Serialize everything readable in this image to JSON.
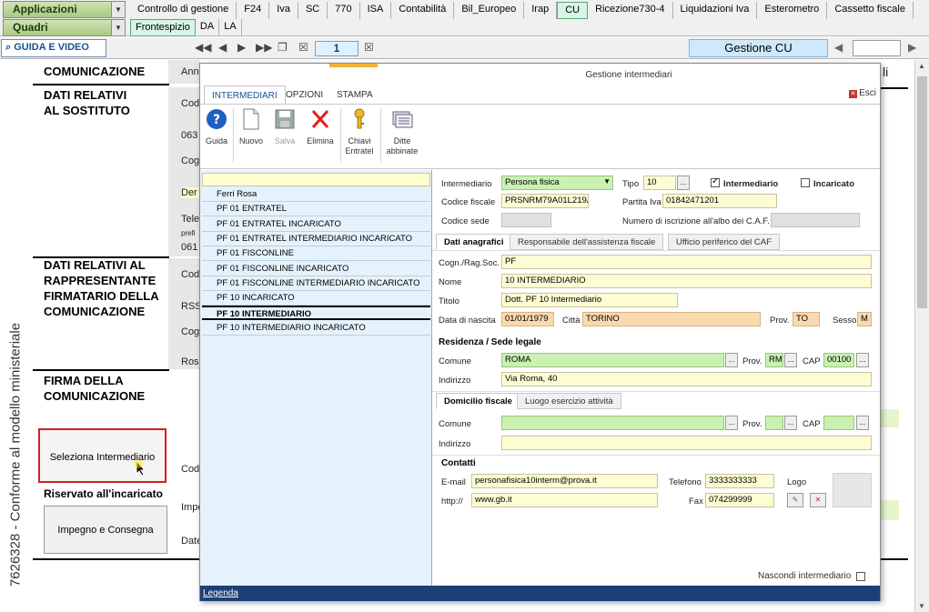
{
  "topbar": {
    "applicazioni": "Applicazioni",
    "quadri": "Quadri",
    "tabs_row1": [
      "Controllo di gestione",
      "F24",
      "Iva",
      "SC",
      "770",
      "ISA",
      "Contabilità",
      "Bil_Europeo",
      "Irap",
      "CU",
      "Ricezione730-4",
      "Liquidazioni Iva",
      "Esterometro",
      "Cassetto fiscale"
    ],
    "tabs_row2": [
      "Frontespizio",
      "DA",
      "LA"
    ],
    "active_tab_row1": "CU",
    "active_tab_row2": "Frontespizio"
  },
  "toolbar": {
    "guida": "GUIDA E VIDEO",
    "page": "1",
    "gestione": "Gestione CU"
  },
  "form": {
    "vertical_text": "7626328 - Conforme al modello ministeriale",
    "sections": {
      "comunicazione": "COMUNICAZIONE",
      "sostituto_1": "DATI RELATIVI",
      "sostituto_2": "AL SOSTITUTO",
      "rappr_1": "DATI RELATIVI AL",
      "rappr_2": "RAPPRESENTANTE",
      "rappr_3": "FIRMATARIO DELLA",
      "rappr_4": "COMUNICAZIONE",
      "firma_1": "FIRMA DELLA",
      "firma_2": "COMUNICAZIONE"
    },
    "fragments": {
      "ann": "Ann",
      "cod1": "Cod",
      "n063": "063",
      "cog1": "Cog",
      "der": "Der",
      "tele": "Tele",
      "prefi": "prefi",
      "n061": "061",
      "cod2": "Cod",
      "rss": "RSS",
      "cog2": "Cog",
      "ros": "Ros",
      "cod3": "Cod",
      "impe": "Impe",
      "date": "Date",
      "li": "li"
    },
    "seleziona": "Seleziona Intermediario",
    "riservato": "Riservato all'incaricato",
    "impegno": "Impegno e Consegna"
  },
  "dialog": {
    "title": "Gestione intermediari",
    "tabs": [
      "INTERMEDIARI",
      "OPZIONI",
      "STAMPA"
    ],
    "esci": "Esci",
    "ribbon": [
      {
        "label": "Guida",
        "icon": "help-icon",
        "disabled": false
      },
      {
        "label": "Nuovo",
        "icon": "new-document-icon",
        "disabled": false
      },
      {
        "label": "Salva",
        "icon": "save-icon",
        "disabled": true
      },
      {
        "label": "Elimina",
        "icon": "delete-icon",
        "disabled": false
      },
      {
        "label": "Chiavi\nEntratel",
        "icon": "key-icon",
        "disabled": false
      },
      {
        "label": "Ditte\nabbinate",
        "icon": "linked-companies-icon",
        "disabled": false
      }
    ],
    "list": [
      "Ferri Rosa",
      "PF 01 ENTRATEL",
      "PF 01 ENTRATEL INCARICATO",
      "PF 01 ENTRATEL INTERMEDIARIO INCARICATO",
      "PF 01 FISCONLINE",
      "PF 01 FISCONLINE INCARICATO",
      "PF 01 FISCONLINE INTERMEDIARIO INCARICATO",
      "PF 10 INCARICATO",
      "PF 10 INTERMEDIARIO",
      "PF 10 INTERMEDIARIO INCARICATO"
    ],
    "selected_index": 8,
    "legenda": "Legenda",
    "nascondi": "Nascondi intermediario",
    "detail": {
      "intermediario_label": "Intermediario",
      "intermediario_value": "Persona fisica",
      "tipo_label": "Tipo",
      "tipo_value": "10",
      "chk_intermediario": "Intermediario",
      "chk_incaricato": "Incaricato",
      "cf_label": "Codice fiscale",
      "cf_value": "PRSNRM79A01L219A",
      "piva_label": "Partita Iva",
      "piva_value": "01842471201",
      "codsede_label": "Codice sede",
      "albo_label": "Numero di iscrizione all'albo dei C.A.F.",
      "subtabs": [
        "Dati anagrafici",
        "Responsabile dell'assistenza fiscale",
        "Ufficio periferico del CAF"
      ],
      "cognome_label": "Cogn./Rag.Soc.",
      "cognome_value": "PF",
      "nome_label": "Nome",
      "nome_value": "10 INTERMEDIARIO",
      "titolo_label": "Titolo",
      "titolo_value": "Dott. PF 10 Intermediario",
      "nascita_label": "Data di nascita",
      "nascita_value": "01/01/1979",
      "citta_label": "Città",
      "citta_value": "TORINO",
      "prov_label": "Prov.",
      "prov_value": "TO",
      "sesso_label": "Sesso",
      "sesso_value": "M",
      "residenza_header": "Residenza / Sede legale",
      "comune_label": "Comune",
      "comune_value": "ROMA",
      "res_prov_value": "RM",
      "cap_label": "CAP",
      "cap_value": "00100",
      "indirizzo_label": "Indirizzo",
      "indirizzo_value": "Via Roma, 40",
      "domtabs": [
        "Domicilio fiscale",
        "Luogo esercizio attività"
      ],
      "dom_comune_label": "Comune",
      "dom_prov_label": "Prov.",
      "dom_cap_label": "CAP",
      "dom_indirizzo_label": "Indirizzo",
      "contatti_header": "Contatti",
      "email_label": "E-mail",
      "email_value": "personafisica10interm@prova.it",
      "telefono_label": "Telefono",
      "telefono_value": "3333333333",
      "logo_label": "Logo",
      "http_label": "http://",
      "http_value": "www.gb.it",
      "fax_label": "Fax",
      "fax_value": "074299999"
    }
  },
  "colors": {
    "field_yellow": "#fefcd3",
    "field_green": "#c9f1b2",
    "field_orange": "#fbd9ae",
    "list_bg": "#e6f2fb",
    "footer_blue": "#1c3f78",
    "highlight_red": "#d42020"
  }
}
